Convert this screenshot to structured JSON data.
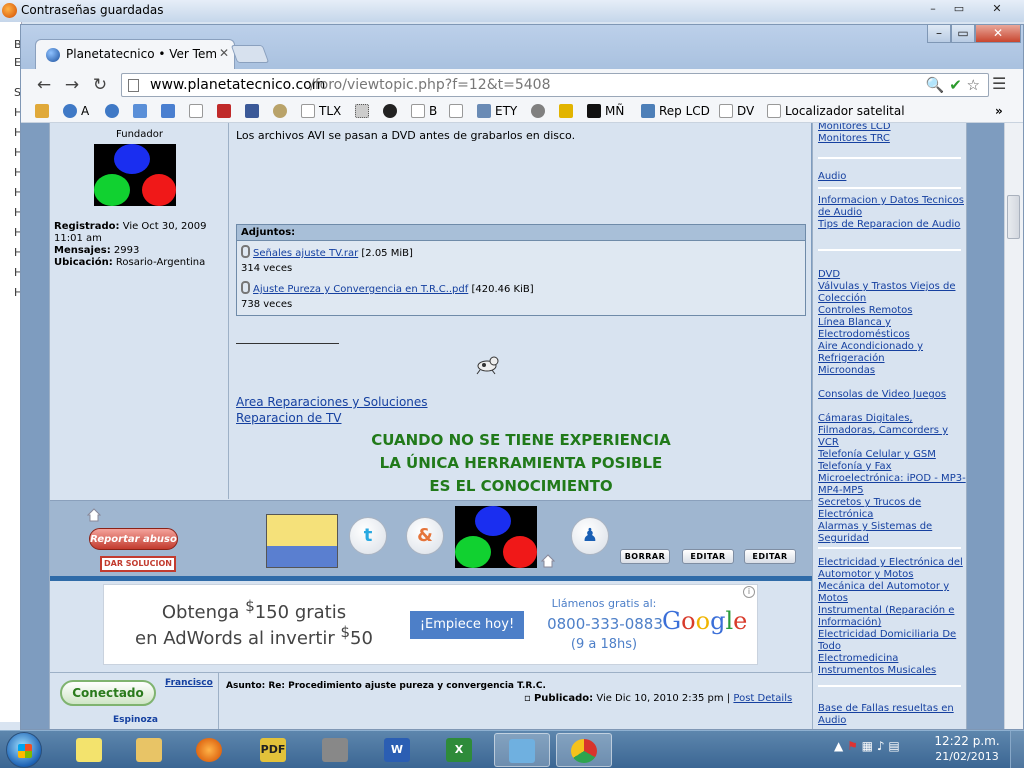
{
  "background_window": {
    "title": "Contraseñas guardadas",
    "side_letters": [
      "B",
      "E",
      "S",
      "H",
      "H",
      "H",
      "H",
      "H",
      "H",
      "H",
      "H",
      "H",
      "H"
    ]
  },
  "browser": {
    "tab_title": "Planetatecnico • Ver Tema",
    "url_host": "www.planetatecnico.com",
    "url_path": "/foro/viewtopic.php?f=12&t=5408",
    "bookmarks": [
      {
        "label": "",
        "icon": "app-icon"
      },
      {
        "label": "A",
        "icon": "globe-icon"
      },
      {
        "label": "",
        "icon": "globe-icon"
      },
      {
        "label": "",
        "icon": "translate-icon"
      },
      {
        "label": "",
        "icon": "google-icon"
      },
      {
        "label": "",
        "icon": "page-icon"
      },
      {
        "label": "",
        "icon": "wr-icon"
      },
      {
        "label": "",
        "icon": "facebook-icon"
      },
      {
        "label": "",
        "icon": "eye-icon"
      },
      {
        "label": "TLX",
        "icon": "page-icon"
      },
      {
        "label": "",
        "icon": "grid-icon"
      },
      {
        "label": "",
        "icon": "n-icon"
      },
      {
        "label": "B",
        "icon": "page-icon"
      },
      {
        "label": "ETY",
        "icon": "sm-icon"
      },
      {
        "label": "",
        "icon": "globe-icon"
      },
      {
        "label": "",
        "icon": "m-icon"
      },
      {
        "label": "MÑ",
        "icon": "so-icon"
      },
      {
        "label": "Rep LCD",
        "icon": "lcd-icon"
      },
      {
        "label": "DV",
        "icon": "page-icon"
      },
      {
        "label": "Localizador satelital",
        "icon": "page-icon"
      }
    ]
  },
  "post": {
    "author_rank": "Fundador",
    "registered_label": "Registrado:",
    "registered_value": "Vie Oct 30, 2009 11:01 am",
    "messages_label": "Mensajes:",
    "messages_value": "2993",
    "location_label": "Ubicación:",
    "location_value": "Rosario-Argentina",
    "body_text": "Los archivos AVI se pasan a DVD antes de grabarlos en disco.",
    "attachments_header": "Adjuntos:",
    "attachments": [
      {
        "name": "Señales ajuste TV.rar",
        "size": "[2.05 MiB]",
        "downloads": "314 veces"
      },
      {
        "name": "Ajuste Pureza y Convergencia en T.R.C..pdf",
        "size": "[420.46 KiB]",
        "downloads": "738 veces"
      }
    ],
    "signature_links": [
      "Area Reparaciones y Soluciones",
      "Reparacion de TV"
    ],
    "signature_quote": [
      "CUANDO NO SE TIENE EXPERIENCIA",
      "LA ÚNICA HERRAMIENTA POSIBLE",
      "ES EL CONOCIMIENTO"
    ],
    "report_button": "Reportar abuso",
    "solve_button": "DAR SOLUCION",
    "action_buttons": [
      "BORRAR",
      "EDITAR",
      "EDITAR"
    ]
  },
  "ad": {
    "line1_pre": "Obtenga ",
    "line1_sup": "$",
    "line1_post": "150 gratis",
    "line2_pre": "en AdWords al invertir ",
    "line2_sup": "$",
    "line2_post": "50",
    "cta": "¡Empiece hoy!",
    "call_label": "Llámenos gratis al:",
    "phone": "0800-333-0883",
    "hours": "(9 a 18hs)",
    "brand": "Google"
  },
  "next_post": {
    "online_label": "Conectado",
    "author_first": "Francisco",
    "author_last": "Espinoza",
    "subject_label": "Asunto:",
    "subject_value": "Re: Procedimiento ajuste pureza y convergencia T.R.C.",
    "published_label": "Publicado:",
    "published_value": "Vie Dic 10, 2010 2:35 pm",
    "separator": "|",
    "details_link": "Post Details"
  },
  "sidebar": {
    "group1": [
      "Monitores LCD",
      "Monitores TRC"
    ],
    "group2": [
      "Audio"
    ],
    "group3": [
      "Informacion y Datos Tecnicos de Audio",
      "Tips de Reparacion de Audio"
    ],
    "group4": [
      "DVD",
      "Válvulas y Trastos Viejos de Colección",
      "Controles Remotos",
      "Línea Blanca y Electrodomésticos",
      "Aire Acondicionado y Refrigeración",
      "Microondas"
    ],
    "group5": [
      "Consolas de Video Juegos",
      "Cámaras Digitales, Filmadoras, Camcorders y VCR",
      "Telefonía Celular y GSM",
      "Telefonía y Fax",
      "Microelectrónica: iPOD - MP3-MP4-MP5",
      "Secretos y Trucos de Electrónica",
      "Alarmas y Sistemas de Seguridad"
    ],
    "group6": [
      "Electricidad y Electrónica del Automotor y Motos",
      "Mecánica del Automotor y Motos",
      "Instrumental (Reparación e Información)",
      "Electricidad Domiciliaria De Todo",
      "Electromedicina",
      "Instrumentos Musicales"
    ],
    "group7": [
      "Base de Fallas resueltas en Audio"
    ]
  },
  "taskbar": {
    "apps": [
      {
        "name": "sticky-notes",
        "label": ""
      },
      {
        "name": "explorer",
        "label": ""
      },
      {
        "name": "firefox",
        "label": ""
      },
      {
        "name": "pdf",
        "label": "PDF"
      },
      {
        "name": "chip-tool",
        "label": ""
      },
      {
        "name": "word",
        "label": "W"
      },
      {
        "name": "excel",
        "label": "X"
      },
      {
        "name": "contacts",
        "label": ""
      },
      {
        "name": "chrome",
        "label": ""
      }
    ],
    "time": "12:22 p.m.",
    "date": "21/02/2013"
  },
  "colors": {
    "link": "#1540a0",
    "quote_green": "#217a1a",
    "report_red": "#c23b2e"
  }
}
